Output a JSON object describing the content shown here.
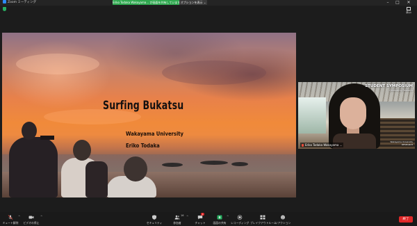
{
  "window": {
    "app_title": "Zoom ミーティング",
    "share_banner": "Eriko Todaka Wakayama... が画面を共有しています",
    "options_button": "オプションを表示 ⌄",
    "controls": {
      "minimize": "–",
      "maximize": "□",
      "close": "✕"
    }
  },
  "view_button": {
    "label": "表示"
  },
  "slide": {
    "title": "Surfing Bukatsu",
    "university": "Wakayama University",
    "presenter": "Eriko Todaka"
  },
  "video": {
    "overlay_title": "STUDENT SYMPOSIUM",
    "overlay_subtitle": "Celebrating Research",
    "participant_name": "Eriko Todaka Wakayama ...",
    "corner_text_1": "Wakayama University",
    "corner_text_2": "RESEARCH"
  },
  "toolbar": {
    "items": [
      {
        "label": "ミュート解除",
        "icon": "mic-muted-icon"
      },
      {
        "label": "ビデオの停止",
        "icon": "video-camera-icon"
      },
      {
        "label": "セキュリティ",
        "icon": "shield-icon"
      },
      {
        "label": "参加者",
        "icon": "participants-icon",
        "count": "16"
      },
      {
        "label": "チャット",
        "icon": "chat-icon",
        "badge": "1"
      },
      {
        "label": "画面の共有",
        "icon": "share-screen-icon"
      },
      {
        "label": "レコーディング",
        "icon": "record-icon"
      },
      {
        "label": "ブレイクアウトルーム",
        "icon": "breakout-rooms-icon"
      },
      {
        "label": "リアクション",
        "icon": "reactions-icon"
      }
    ],
    "end_button": "終了"
  },
  "colors": {
    "share_banner": "#2fa84f",
    "end_button": "#e02828",
    "share_icon": "#27ae60",
    "toolbar_bg": "#1a1a1a"
  }
}
